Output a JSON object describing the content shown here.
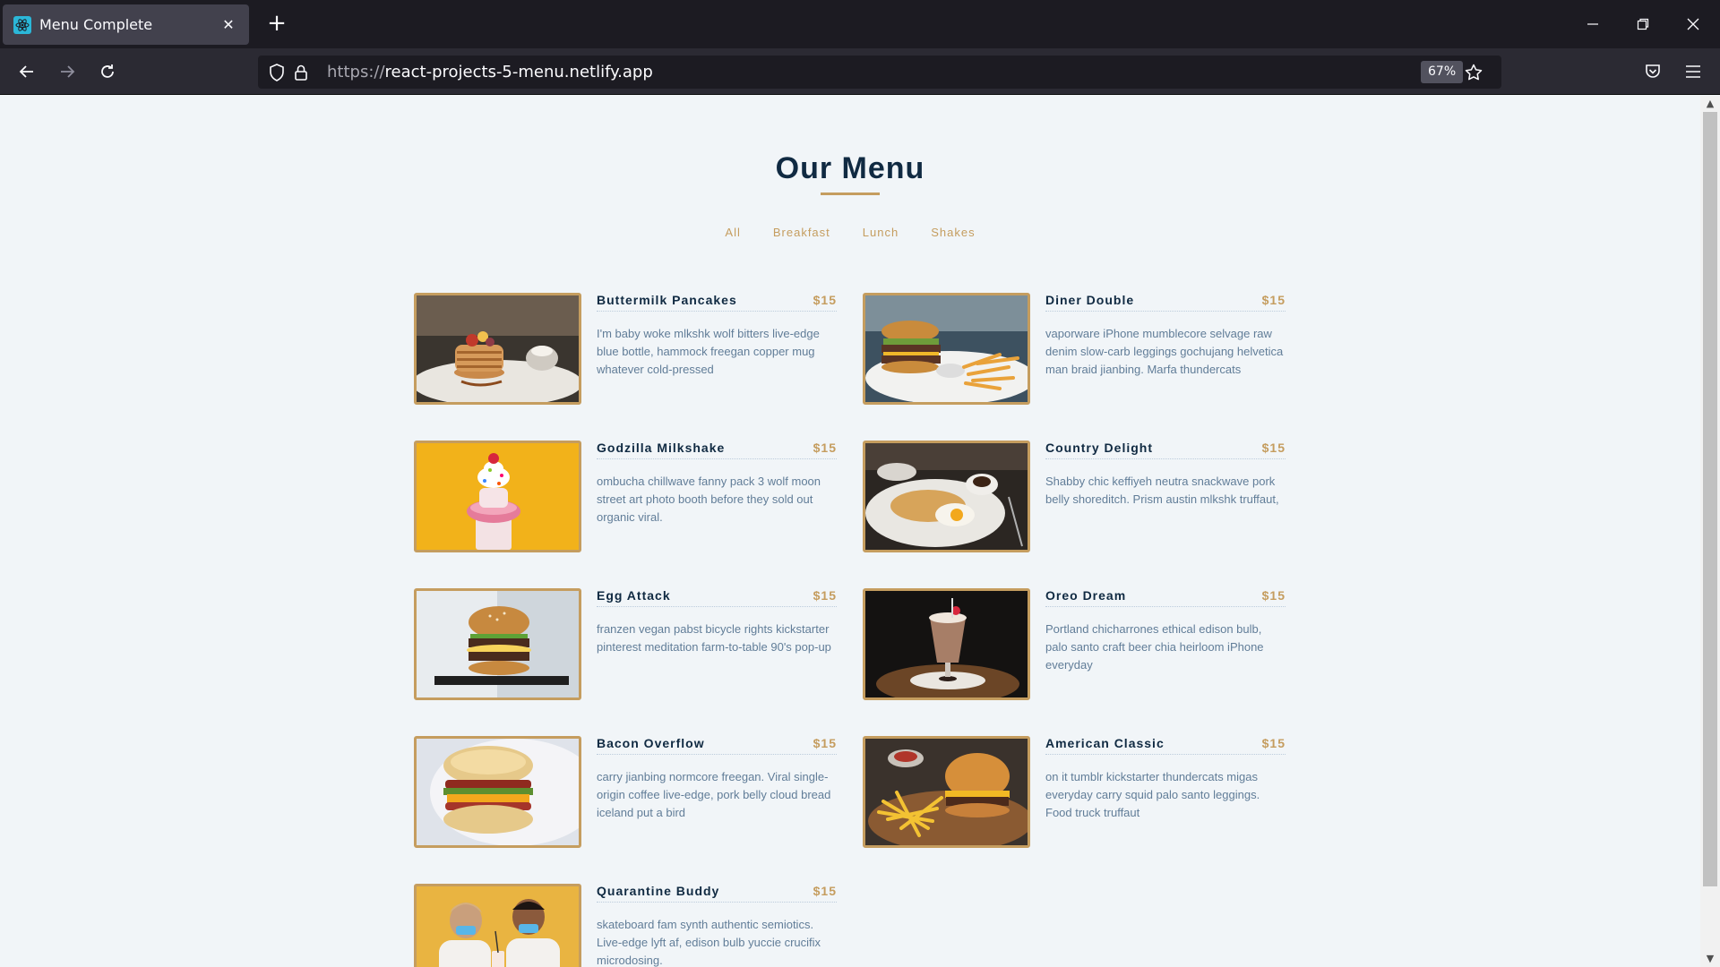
{
  "browser": {
    "tab_title": "Menu Complete",
    "url_scheme": "https://",
    "url_host": "react-projects-5-menu.netlify.app",
    "zoom": "67%"
  },
  "page": {
    "title": "Our Menu",
    "filters": [
      "All",
      "Breakfast",
      "Lunch",
      "Shakes"
    ],
    "items": [
      {
        "name": "Buttermilk Pancakes",
        "price": "$15",
        "desc": "I'm baby woke mlkshk wolf bitters live-edge blue bottle, hammock freegan copper mug whatever cold-pressed"
      },
      {
        "name": "Diner Double",
        "price": "$15",
        "desc": "vaporware iPhone mumblecore selvage raw denim slow-carb leggings gochujang helvetica man braid jianbing. Marfa thundercats"
      },
      {
        "name": "Godzilla Milkshake",
        "price": "$15",
        "desc": "ombucha chillwave fanny pack 3 wolf moon street art photo booth before they sold out organic viral."
      },
      {
        "name": "Country Delight",
        "price": "$15",
        "desc": "Shabby chic keffiyeh neutra snackwave pork belly shoreditch. Prism austin mlkshk truffaut,"
      },
      {
        "name": "Egg Attack",
        "price": "$15",
        "desc": "franzen vegan pabst bicycle rights kickstarter pinterest meditation farm-to-table 90's pop-up"
      },
      {
        "name": "Oreo Dream",
        "price": "$15",
        "desc": "Portland chicharrones ethical edison bulb, palo santo craft beer chia heirloom iPhone everyday"
      },
      {
        "name": "Bacon Overflow",
        "price": "$15",
        "desc": "carry jianbing normcore freegan. Viral single-origin coffee live-edge, pork belly cloud bread iceland put a bird"
      },
      {
        "name": "American Classic",
        "price": "$15",
        "desc": "on it tumblr kickstarter thundercats migas everyday carry squid palo santo leggings. Food truck truffaut"
      },
      {
        "name": "Quarantine Buddy",
        "price": "$15",
        "desc": "skateboard fam synth authentic semiotics. Live-edge lyft af, edison bulb yuccie crucifix microdosing."
      }
    ]
  },
  "colors": {
    "accent": "#c59d5f",
    "title": "#102a42",
    "text": "#617d98",
    "background": "#f1f5f8"
  }
}
